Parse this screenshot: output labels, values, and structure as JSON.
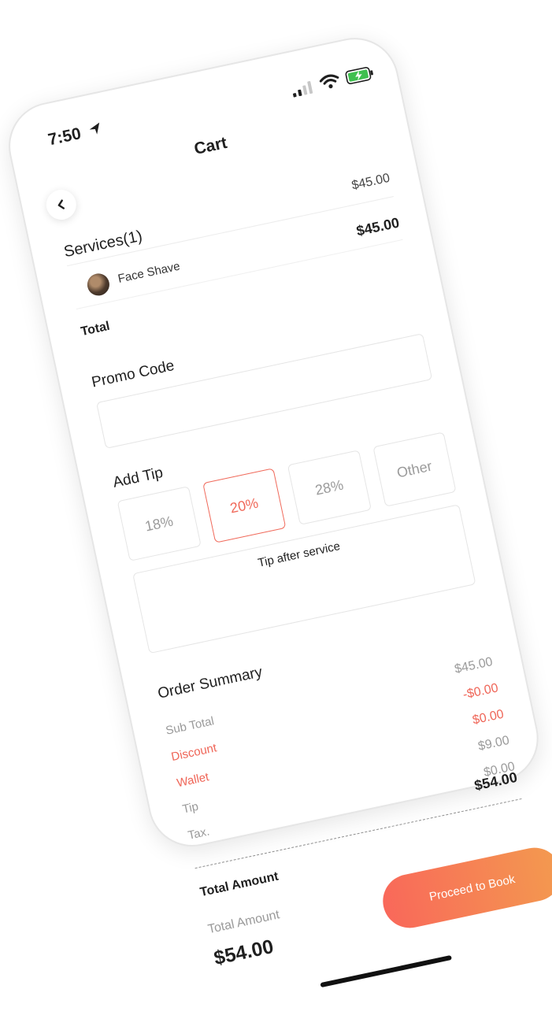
{
  "status_bar": {
    "time": "7:50"
  },
  "header": {
    "title": "Cart"
  },
  "services": {
    "heading": "Services(1)",
    "price": "$45.00",
    "items": [
      {
        "name": "Face Shave",
        "price": "$45.00"
      }
    ],
    "total_label": "Total"
  },
  "promo": {
    "label": "Promo Code",
    "placeholder": ""
  },
  "tip": {
    "label": "Add Tip",
    "options": [
      "18%",
      "20%",
      "28%",
      "Other"
    ],
    "selected": "20%",
    "after_service": "Tip after service"
  },
  "order_summary": {
    "title": "Order Summary",
    "rows": [
      {
        "label": "Sub Total",
        "value": "$45.00"
      },
      {
        "label": "Discount",
        "value": "-$0.00"
      },
      {
        "label": "Wallet",
        "value": "$0.00"
      },
      {
        "label": "Tip",
        "value": "$9.00"
      },
      {
        "label": "Tax.",
        "value": "$0.00"
      }
    ],
    "total_label": "Total Amount",
    "total_value": "$54.00"
  },
  "footer": {
    "total_label": "Total Amount",
    "total_value": "$54.00",
    "cta_label": "Proceed to Book"
  },
  "colors": {
    "accent": "#f0695a",
    "gradient_end": "#f39a4f",
    "battery": "#3fbf4f"
  },
  "icons": [
    "location-arrow-icon",
    "cellular-signal-icon",
    "wifi-icon",
    "battery-charging-icon",
    "chevron-left-icon"
  ]
}
